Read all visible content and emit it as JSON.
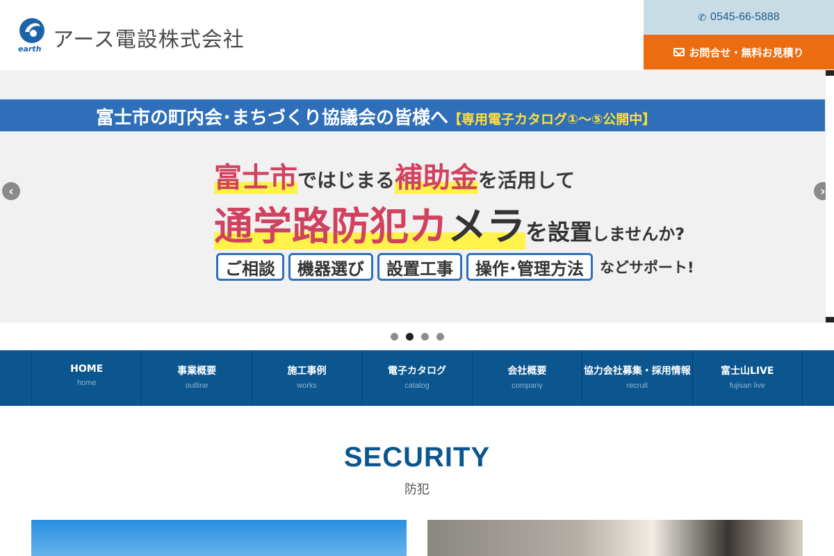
{
  "header": {
    "company_name": "アース電設株式会社",
    "logo_sub": "earth",
    "phone": "0545-66-5888",
    "contact_label": "お問合せ・無料お見積り"
  },
  "slider": {
    "band_text": "富士市の町内会･まちづくり協議会の皆様へ",
    "band_highlight": "【専用電子カタログ①～⑤公開中】",
    "copy_line1": [
      "富士市",
      "ではじまる",
      "補助金",
      "を活用して"
    ],
    "copy_line2": [
      "通学路",
      "防犯",
      "カ",
      "メラ",
      "を設置",
      "しませんか?"
    ],
    "tags": [
      "ご相談",
      "機器選び",
      "設置工事",
      "操作･管理方法"
    ],
    "tags_tail": "などサポート!",
    "prev_arrow": "‹",
    "next_arrow": "›",
    "dots_count": 4,
    "active_dot": 2
  },
  "nav": {
    "items": [
      {
        "label": "HOME",
        "sub": "home"
      },
      {
        "label": "事業概要",
        "sub": "outline"
      },
      {
        "label": "施工事例",
        "sub": "works"
      },
      {
        "label": "電子カタログ",
        "sub": "catalog"
      },
      {
        "label": "会社概要",
        "sub": "company"
      },
      {
        "label": "協力会社募集・採用情報",
        "sub": "recruit"
      },
      {
        "label": "富士山LIVE",
        "sub": "fujisan live"
      }
    ]
  },
  "section": {
    "title": "SECURITY",
    "subtitle": "防犯"
  },
  "colors": {
    "brand_blue": "#0b568e",
    "accent_orange": "#ee6c10",
    "phone_bg": "#c8dce6",
    "slide_band": "#2f6fb9",
    "highlight_red": "#d1425f"
  }
}
